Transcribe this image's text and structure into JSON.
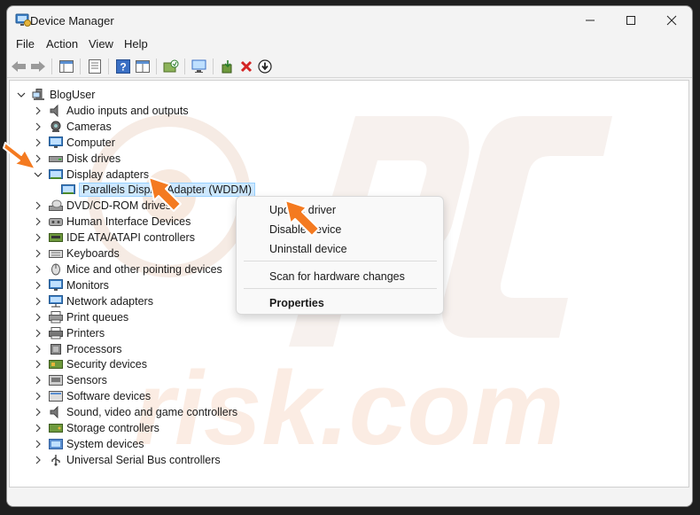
{
  "window": {
    "title": "Device Manager"
  },
  "menu": [
    "File",
    "Action",
    "View",
    "Help"
  ],
  "tree": {
    "root": "BlogUser",
    "categories": [
      {
        "label": "Audio inputs and outputs",
        "icon": "speaker-icon"
      },
      {
        "label": "Cameras",
        "icon": "camera-icon"
      },
      {
        "label": "Computer",
        "icon": "monitor-icon"
      },
      {
        "label": "Disk drives",
        "icon": "disk-drive-icon"
      },
      {
        "label": "Display adapters",
        "icon": "display-adapter-icon",
        "expanded": true
      },
      {
        "label": "DVD/CD-ROM drives",
        "icon": "dvd-icon"
      },
      {
        "label": "Human Interface Devices",
        "icon": "hid-icon"
      },
      {
        "label": "IDE ATA/ATAPI controllers",
        "icon": "ide-controller-icon"
      },
      {
        "label": "Keyboards",
        "icon": "keyboard-icon"
      },
      {
        "label": "Mice and other pointing devices",
        "icon": "mouse-icon"
      },
      {
        "label": "Monitors",
        "icon": "monitor-icon"
      },
      {
        "label": "Network adapters",
        "icon": "network-adapter-icon"
      },
      {
        "label": "Print queues",
        "icon": "print-queue-icon"
      },
      {
        "label": "Printers",
        "icon": "printer-icon"
      },
      {
        "label": "Processors",
        "icon": "processor-icon"
      },
      {
        "label": "Security devices",
        "icon": "security-icon"
      },
      {
        "label": "Sensors",
        "icon": "sensor-icon"
      },
      {
        "label": "Software devices",
        "icon": "software-device-icon"
      },
      {
        "label": "Sound, video and game controllers",
        "icon": "speaker-icon"
      },
      {
        "label": "Storage controllers",
        "icon": "storage-icon"
      },
      {
        "label": "System devices",
        "icon": "system-device-icon"
      },
      {
        "label": "Universal Serial Bus controllers",
        "icon": "usb-icon"
      }
    ],
    "selected_child": "Parallels Display Adapter (WDDM)"
  },
  "context_menu": {
    "update_driver": "Update driver",
    "disable_device": "Disable device",
    "uninstall_device": "Uninstall device",
    "scan_hardware": "Scan for hardware changes",
    "properties": "Properties"
  },
  "colors": {
    "selection_bg": "#cde8ff",
    "annotation_arrow": "#f47a20",
    "watermark": "#f6e6dc"
  }
}
